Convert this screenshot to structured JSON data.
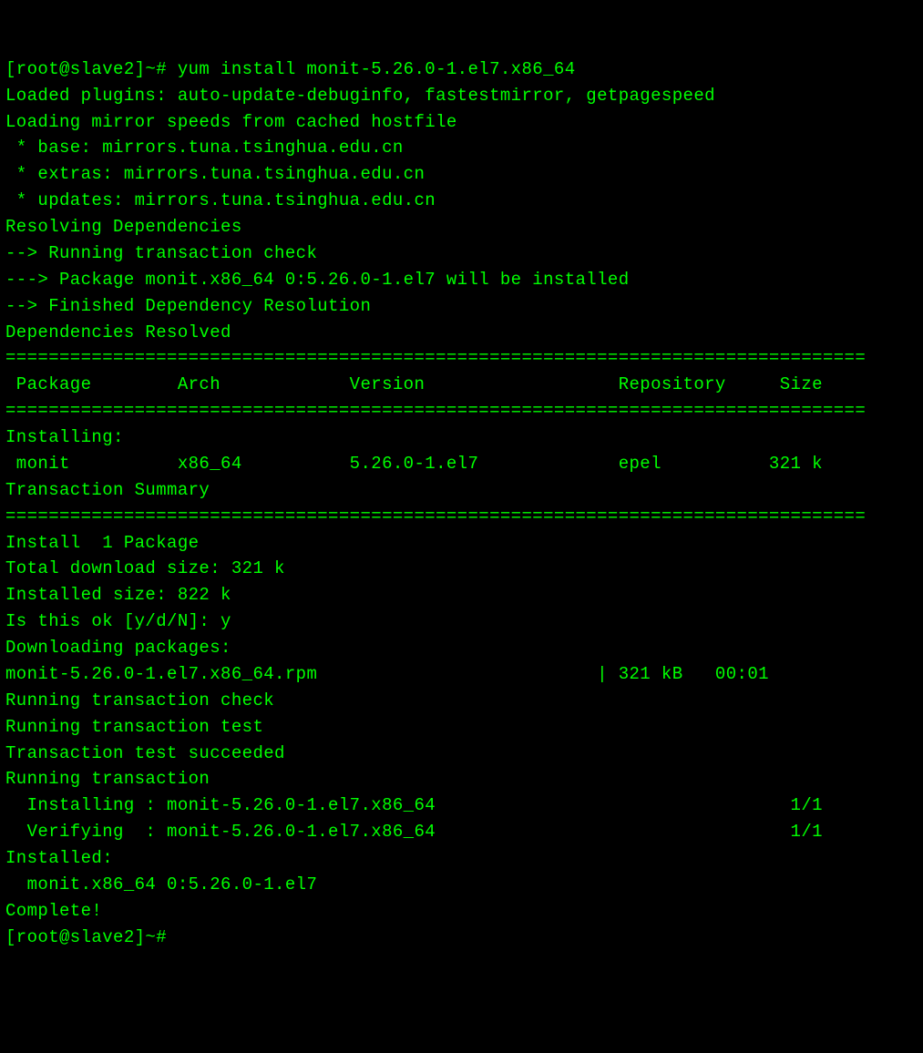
{
  "lines": [
    "[root@slave2]~# yum install monit-5.26.0-1.el7.x86_64",
    "Loaded plugins: auto-update-debuginfo, fastestmirror, getpagespeed",
    "Loading mirror speeds from cached hostfile",
    " * base: mirrors.tuna.tsinghua.edu.cn",
    " * extras: mirrors.tuna.tsinghua.edu.cn",
    " * updates: mirrors.tuna.tsinghua.edu.cn",
    "Resolving Dependencies",
    "--> Running transaction check",
    "---> Package monit.x86_64 0:5.26.0-1.el7 will be installed",
    "--> Finished Dependency Resolution",
    "",
    "Dependencies Resolved",
    "",
    "================================================================================",
    " Package        Arch            Version                  Repository     Size",
    "================================================================================",
    "Installing:",
    " monit          x86_64          5.26.0-1.el7             epel          321 k",
    "",
    "Transaction Summary",
    "================================================================================",
    "Install  1 Package",
    "",
    "Total download size: 321 k",
    "Installed size: 822 k",
    "Is this ok [y/d/N]: y",
    "Downloading packages:",
    "monit-5.26.0-1.el7.x86_64.rpm                          | 321 kB   00:01",
    "Running transaction check",
    "Running transaction test",
    "Transaction test succeeded",
    "Running transaction",
    "  Installing : monit-5.26.0-1.el7.x86_64                                 1/1",
    "  Verifying  : monit-5.26.0-1.el7.x86_64                                 1/1",
    "",
    "Installed:",
    "  monit.x86_64 0:5.26.0-1.el7",
    "",
    "Complete!",
    "[root@slave2]~#"
  ]
}
